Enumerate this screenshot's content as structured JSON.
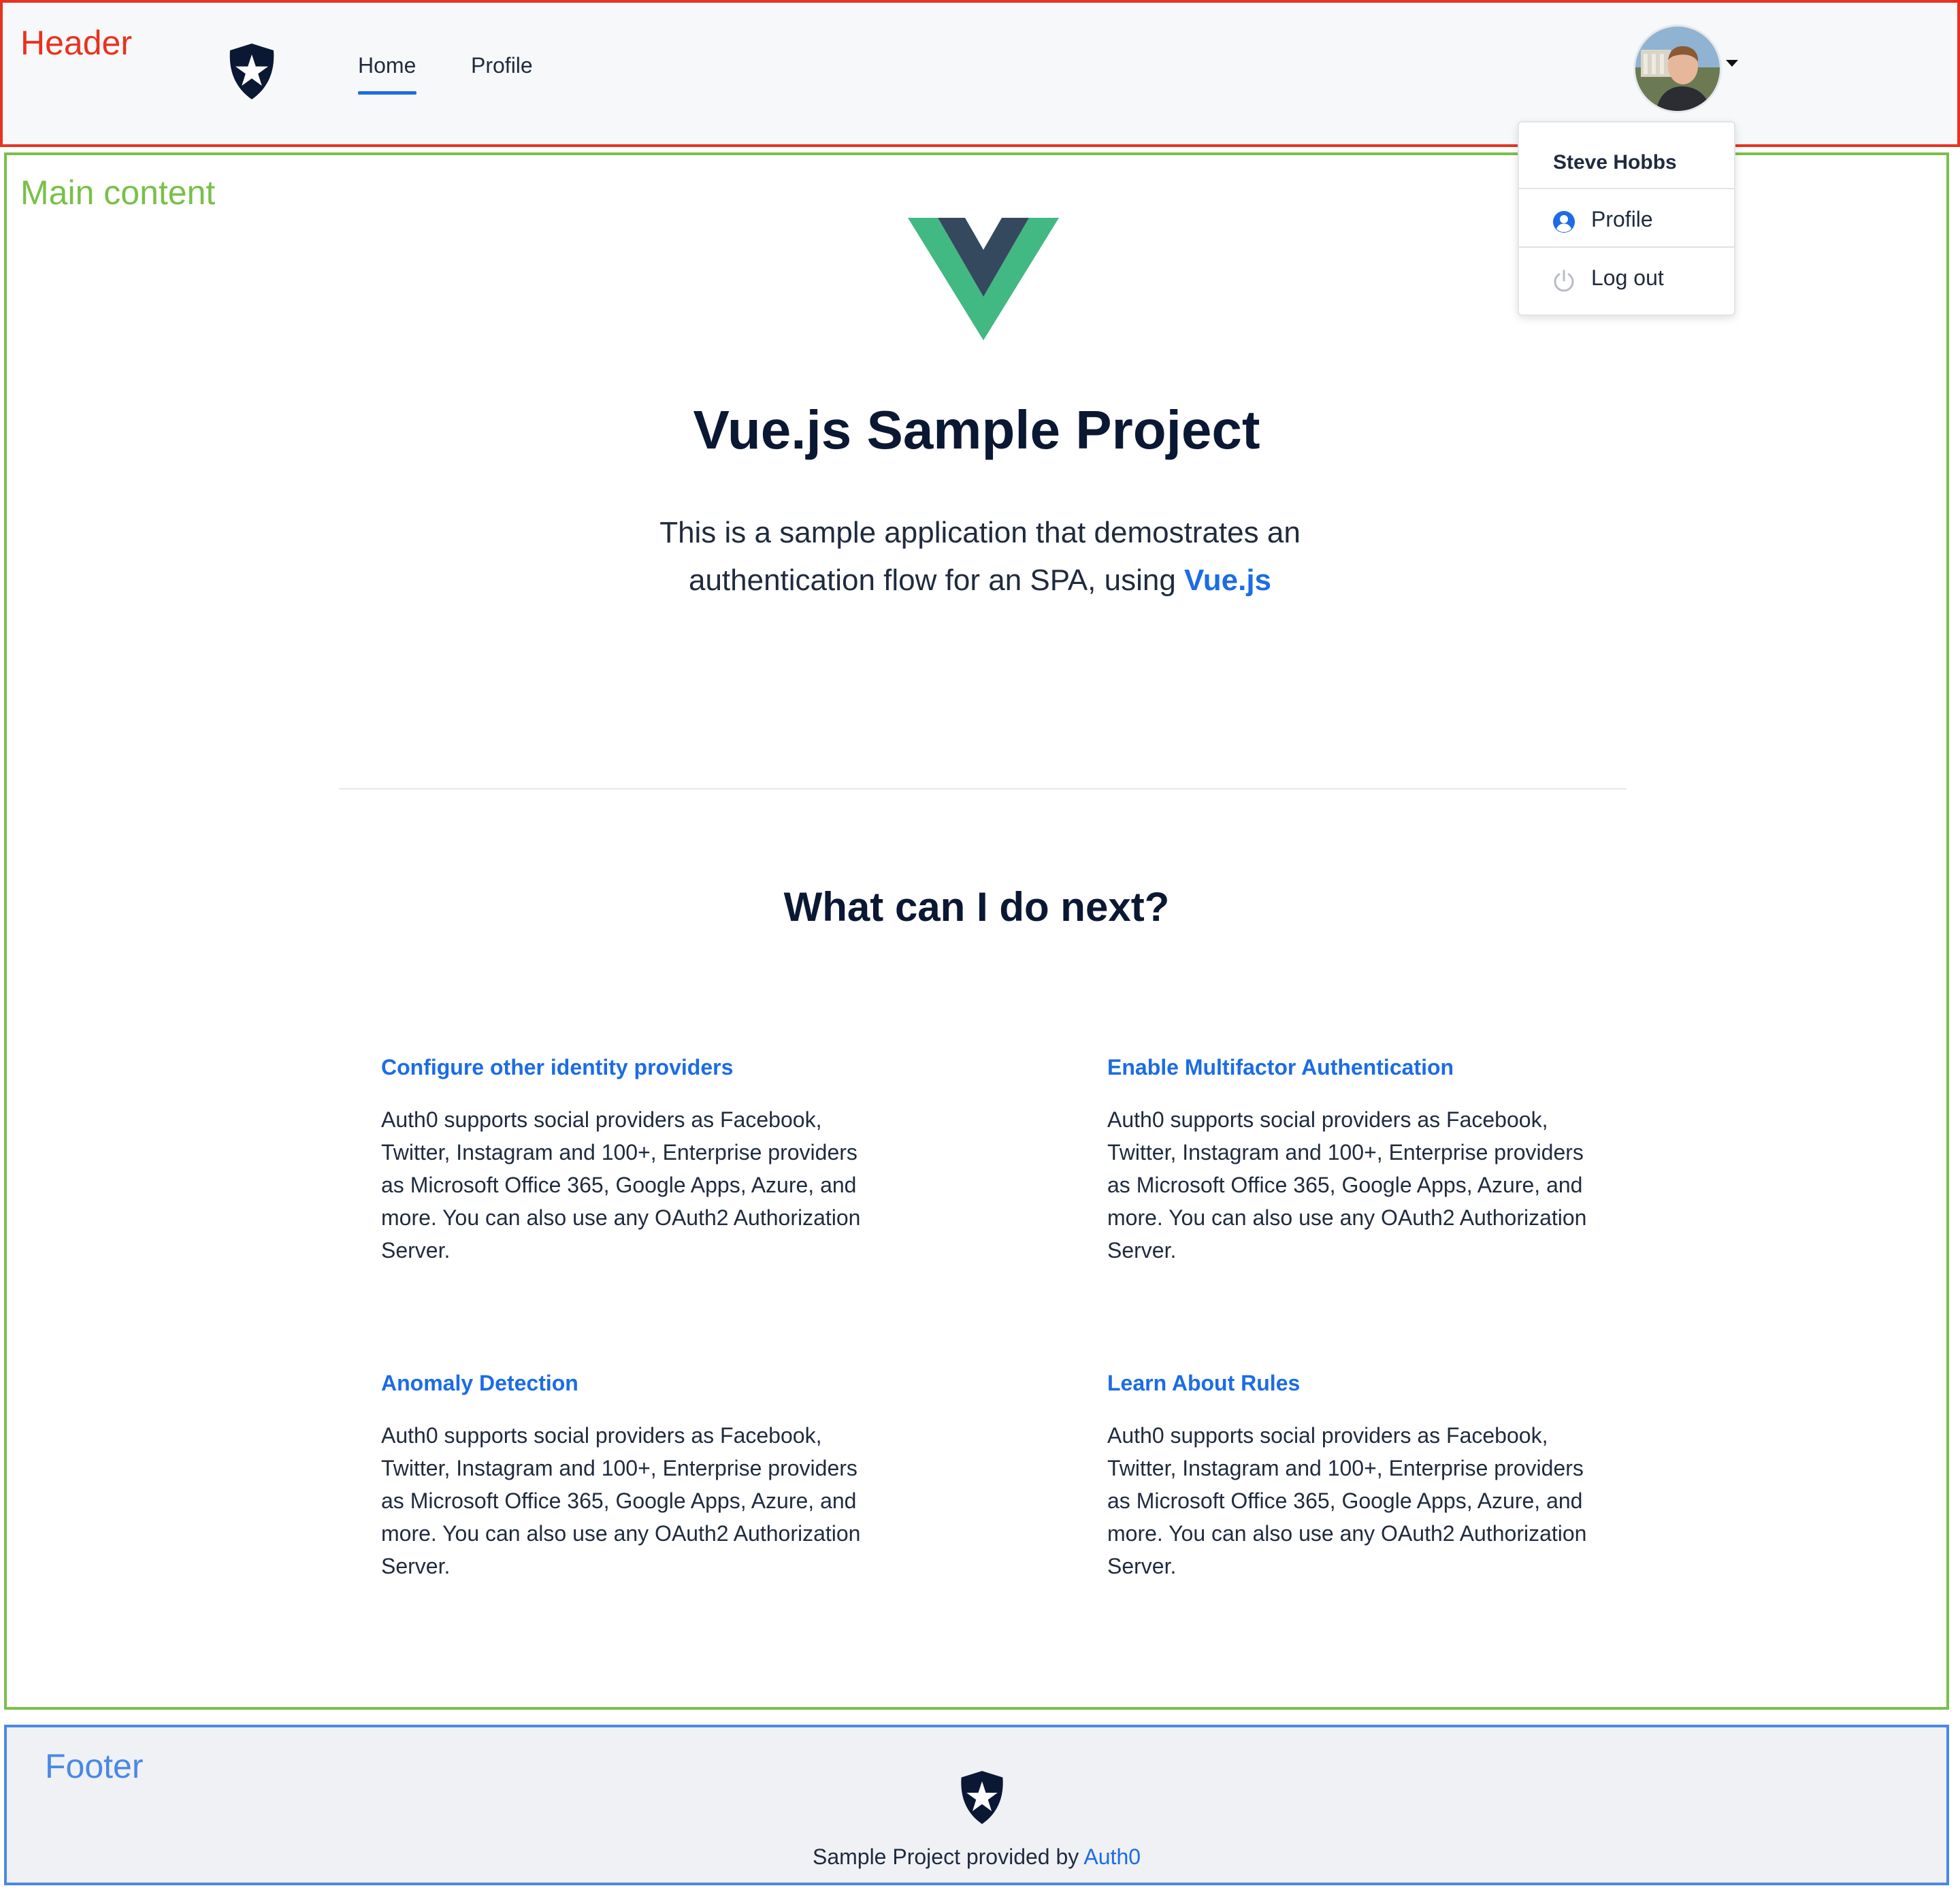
{
  "annotations": {
    "header_label": "Header",
    "main_label": "Main content",
    "footer_label": "Footer"
  },
  "colors": {
    "header_annotation": "#e8321f",
    "main_annotation": "#79c04a",
    "footer_annotation": "#4a88e4",
    "link": "#1c6ce5",
    "heading": "#0b1833",
    "vue_green": "#42b883",
    "vue_dark": "#35495e"
  },
  "header": {
    "logo_icon": "auth0-shield-star-icon",
    "nav": {
      "home": "Home",
      "profile": "Profile",
      "active": "Home"
    },
    "user_menu": {
      "avatar_icon": "user-avatar-photo",
      "caret_icon": "caret-down-icon",
      "name": "Steve Hobbs",
      "items": [
        {
          "label": "Profile",
          "icon": "user-circle-icon"
        },
        {
          "label": "Log out",
          "icon": "power-icon"
        }
      ]
    }
  },
  "hero": {
    "logo_icon": "vue-logo-icon",
    "title": "Vue.js Sample Project",
    "lead_text": "This is a sample application that demostrates an authentication flow for an SPA, using",
    "lead_link": "Vue.js"
  },
  "next_steps": {
    "title": "What can I do next?",
    "cards": [
      {
        "title": "Configure other identity providers",
        "text": "Auth0 supports social providers as Facebook, Twitter, Instagram and 100+, Enterprise providers as Microsoft Office 365, Google Apps, Azure, and more. You can also use any OAuth2 Authorization Server."
      },
      {
        "title": "Enable Multifactor Authentication",
        "text": "Auth0 supports social providers as Facebook, Twitter, Instagram and 100+, Enterprise providers as Microsoft Office 365, Google Apps, Azure, and more. You can also use any OAuth2 Authorization Server."
      },
      {
        "title": "Anomaly Detection",
        "text": "Auth0 supports social providers as Facebook, Twitter, Instagram and 100+, Enterprise providers as Microsoft Office 365, Google Apps, Azure, and more. You can also use any OAuth2 Authorization Server."
      },
      {
        "title": "Learn About Rules",
        "text": "Auth0 supports social providers as Facebook, Twitter, Instagram and 100+, Enterprise providers as Microsoft Office 365, Google Apps, Azure, and more. You can also use any OAuth2 Authorization Server."
      }
    ]
  },
  "footer": {
    "logo_icon": "auth0-shield-star-icon",
    "text": "Sample Project provided by",
    "link": "Auth0"
  }
}
